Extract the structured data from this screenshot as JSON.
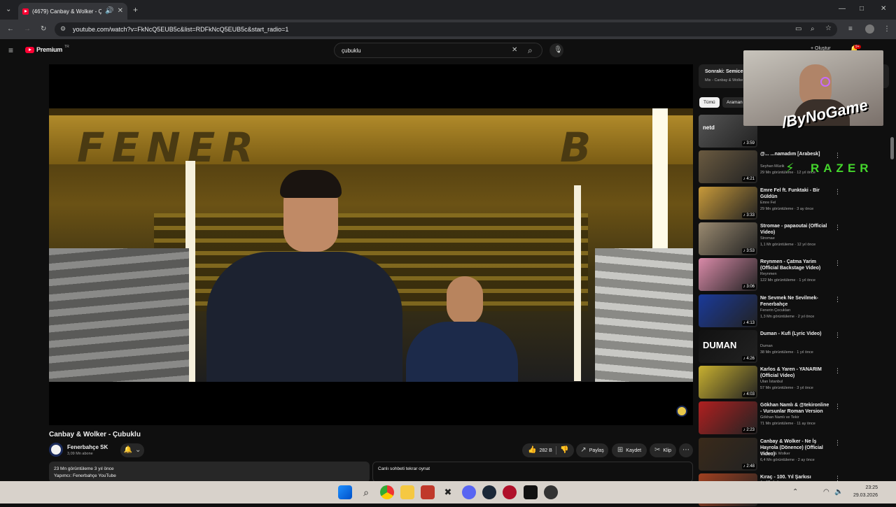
{
  "browser": {
    "tab_title": "(4679) Canbay & Wolker - Ç",
    "url": "youtube.com/watch?v=FkNcQ5EUB5c&list=RDFkNcQ5EUB5c&start_radio=1"
  },
  "youtube": {
    "logo_text": "Premium",
    "logo_badge": "TR",
    "search_value": "çubuklu",
    "create_label": "Oluştur",
    "notif_count": "9+"
  },
  "video": {
    "title": "Canbay & Wolker - Çubuklu",
    "channel": "Fenerbahçe SK",
    "subscribers": "3,09 Mn abone",
    "like_count": "282 B",
    "share_label": "Paylaş",
    "save_label": "Kaydet",
    "clip_label": "Klip",
    "views_date": "23 Mn görüntüleme  3 yıl önce",
    "producer": "Yapımcı: Fenerbahçe YouTube",
    "chat_replay": "Canlı sohbeti tekrar oynat"
  },
  "playlist": {
    "next_label": "Sonraki: Semicen",
    "mix_label": "Mix - Canbay & Wolke"
  },
  "chips": [
    "Tümü",
    "Araman"
  ],
  "overlay": {
    "streamer": "/ByNoGame",
    "brand": "RAZER"
  },
  "sidebar": [
    {
      "title": "",
      "channel": "",
      "meta": "",
      "duration": "3:59",
      "thumb": "#555",
      "thumb_text": "netd"
    },
    {
      "title": "@... ...namadım [Arabesk]",
      "channel": "Seyhan Müzik",
      "meta": "29 Mn görüntüleme · 12 yıl önce",
      "duration": "4:21",
      "thumb": "#6a5a40",
      "thumb_text": ""
    },
    {
      "title": "Emre Fel ft. Funktaki - Bir Güldün",
      "channel": "Emre Fel",
      "meta": "29 Mn görüntüleme · 3 ay önce",
      "duration": "3:33",
      "thumb": "#c89a3a",
      "thumb_text": ""
    },
    {
      "title": "Stromae - papaoutai (Official Video)",
      "channel": "Stromae",
      "meta": "1,1 Mr görüntüleme · 12 yıl önce",
      "duration": "3:53",
      "thumb": "#9a8a70",
      "thumb_text": ""
    },
    {
      "title": "Reynmen - Çatma Yarim (Official Backstage Video)",
      "channel": "Reynmen",
      "meta": "122 Mn görüntüleme · 1 yıl önce",
      "duration": "3:06",
      "thumb": "#d98aa8",
      "thumb_text": ""
    },
    {
      "title": "Ne Sevmek Ne Sevilmek- Fenerbahçe",
      "channel": "Fenerin Çocukları",
      "meta": "1,3 Mn görüntüleme · 2 yıl önce",
      "duration": "4:13",
      "thumb": "#1a3a9a",
      "thumb_text": ""
    },
    {
      "title": "Duman - Kufi (Lyric Video)",
      "channel": "Duman",
      "meta": "38 Mn görüntüleme · 1 yıl önce",
      "duration": "4:26",
      "thumb": "#111",
      "thumb_text": "DUMAN"
    },
    {
      "title": "Karlos & Yaren - YANARIM (Official Video)",
      "channel": "Ulan İstanbul",
      "meta": "57 Mn görüntüleme · 3 yıl önce",
      "duration": "4:03",
      "thumb": "#c8b030",
      "thumb_text": ""
    },
    {
      "title": "Gökhan Namlı & @tekironline - Vursunlar Roman Version",
      "channel": "Gökhan Namlı ve Tekir",
      "meta": "71 Mn görüntüleme · 11 ay önce",
      "duration": "2:23",
      "thumb": "#b02020",
      "thumb_text": ""
    },
    {
      "title": "Canbay & Wolker - Ne İş Hayrola (Dönence) (Official Video)",
      "channel": "Canbay & Wolker",
      "meta": "6,4 Mn görüntüleme · 2 ay önce",
      "duration": "2:48",
      "thumb": "#3a2a1a",
      "thumb_text": ""
    },
    {
      "title": "Kıraç - 100. Yıl Şarkısı (Official",
      "channel": "",
      "meta": "",
      "duration": "",
      "thumb": "#a04020",
      "thumb_text": ""
    }
  ],
  "taskbar": {
    "time": "23:25",
    "date": "29.03.2026"
  }
}
